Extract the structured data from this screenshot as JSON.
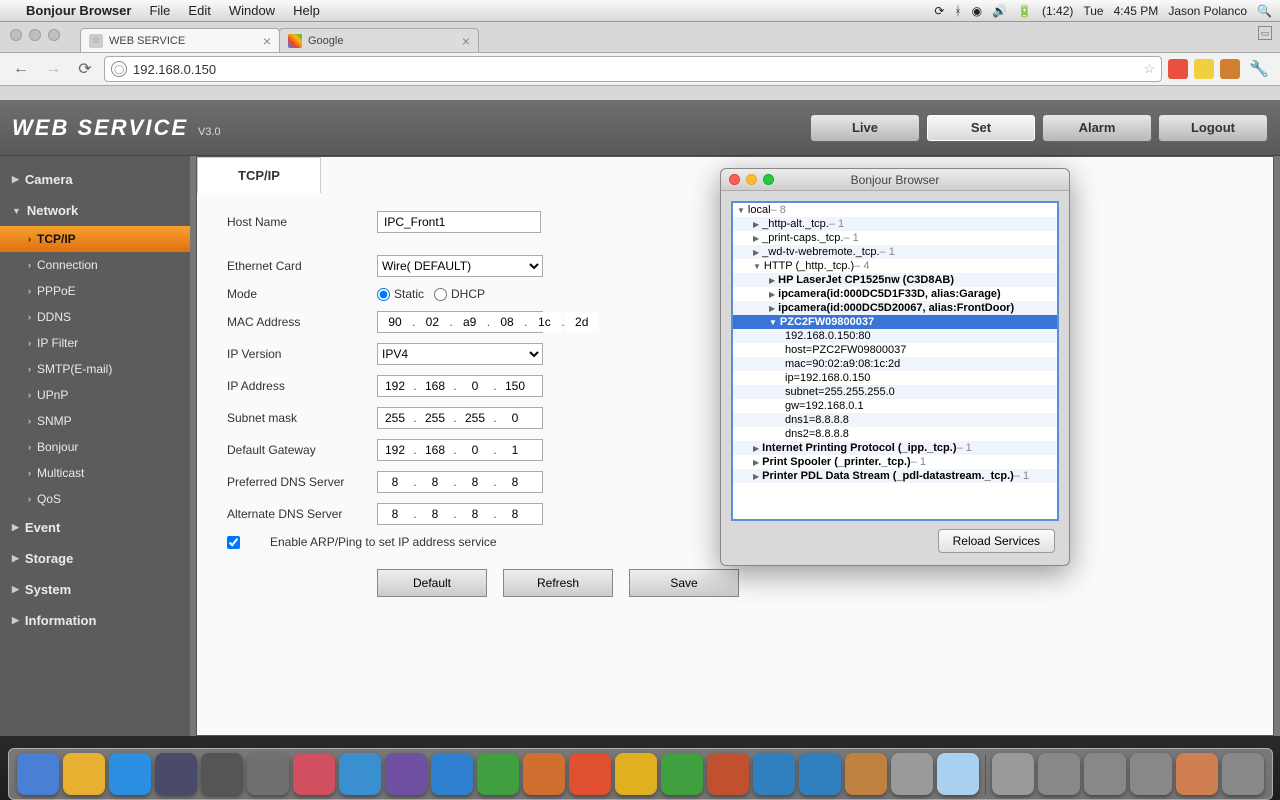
{
  "menubar": {
    "app": "Bonjour Browser",
    "items": [
      "File",
      "Edit",
      "Window",
      "Help"
    ],
    "battery": "(1:42)",
    "day": "Tue",
    "time": "4:45 PM",
    "user": "Jason Polanco"
  },
  "chrome": {
    "tabs": [
      {
        "title": "WEB SERVICE",
        "active": true
      },
      {
        "title": "Google",
        "active": false
      }
    ],
    "url": "192.168.0.150"
  },
  "webservice": {
    "logo_main": "WEB  SERVICE",
    "logo_ver": "V3.0",
    "topnav": [
      "Live",
      "Set",
      "Alarm",
      "Logout"
    ],
    "topnav_active": 1,
    "sidebar": {
      "categories": [
        {
          "label": "Camera",
          "expanded": false
        },
        {
          "label": "Network",
          "expanded": true,
          "subs": [
            "TCP/IP",
            "Connection",
            "PPPoE",
            "DDNS",
            "IP Filter",
            "SMTP(E-mail)",
            "UPnP",
            "SNMP",
            "Bonjour",
            "Multicast",
            "QoS"
          ],
          "active": 0
        },
        {
          "label": "Event",
          "expanded": false
        },
        {
          "label": "Storage",
          "expanded": false
        },
        {
          "label": "System",
          "expanded": false
        },
        {
          "label": "Information",
          "expanded": false
        }
      ]
    },
    "panel": {
      "tab": "TCP/IP",
      "host_label": "Host Name",
      "host_value": "IPC_Front1",
      "eth_label": "Ethernet Card",
      "eth_value": "Wire( DEFAULT)",
      "mode_label": "Mode",
      "mode_static": "Static",
      "mode_dhcp": "DHCP",
      "mode_value": "static",
      "mac_label": "MAC Address",
      "mac": [
        "90",
        "02",
        "a9",
        "08",
        "1c",
        "2d"
      ],
      "ipver_label": "IP Version",
      "ipver_value": "IPV4",
      "ipaddr_label": "IP Address",
      "ipaddr": [
        "192",
        "168",
        "0",
        "150"
      ],
      "subnet_label": "Subnet mask",
      "subnet": [
        "255",
        "255",
        "255",
        "0"
      ],
      "gw_label": "Default Gateway",
      "gw": [
        "192",
        "168",
        "0",
        "1"
      ],
      "dns1_label": "Preferred DNS Server",
      "dns1": [
        "8",
        "8",
        "8",
        "8"
      ],
      "dns2_label": "Alternate DNS Server",
      "dns2": [
        "8",
        "8",
        "8",
        "8"
      ],
      "arp_label": "Enable ARP/Ping to set IP address service",
      "arp_checked": true,
      "btn_default": "Default",
      "btn_refresh": "Refresh",
      "btn_save": "Save"
    }
  },
  "bonjour": {
    "title": "Bonjour Browser",
    "reload": "Reload Services",
    "tree": [
      {
        "indent": 0,
        "tri": "▼",
        "text": "local",
        "count": " – 8"
      },
      {
        "indent": 1,
        "tri": "▶",
        "text": "_http-alt._tcp.",
        "count": " – 1"
      },
      {
        "indent": 1,
        "tri": "▶",
        "text": "_print-caps._tcp.",
        "count": " – 1"
      },
      {
        "indent": 1,
        "tri": "▶",
        "text": "_wd-tv-webremote._tcp.",
        "count": " – 1"
      },
      {
        "indent": 1,
        "tri": "▼",
        "text": "HTTP (_http._tcp.)",
        "count": " – 4"
      },
      {
        "indent": 2,
        "tri": "▶",
        "bold": true,
        "text": "HP LaserJet CP1525nw (C3D8AB)"
      },
      {
        "indent": 2,
        "tri": "▶",
        "bold": true,
        "text": "ipcamera(id:000DC5D1F33D, alias:Garage)"
      },
      {
        "indent": 2,
        "tri": "▶",
        "bold": true,
        "text": "ipcamera(id:000DC5D20067, alias:FrontDoor)"
      },
      {
        "indent": 2,
        "tri": "▼",
        "bold": true,
        "text": "PZC2FW09800037",
        "sel": true
      },
      {
        "indent": 3,
        "text": "192.168.0.150:80"
      },
      {
        "indent": 3,
        "text": "host=PZC2FW09800037"
      },
      {
        "indent": 3,
        "text": "mac=90:02:a9:08:1c:2d"
      },
      {
        "indent": 3,
        "text": "ip=192.168.0.150"
      },
      {
        "indent": 3,
        "text": "subnet=255.255.255.0"
      },
      {
        "indent": 3,
        "text": "gw=192.168.0.1"
      },
      {
        "indent": 3,
        "text": "dns1=8.8.8.8"
      },
      {
        "indent": 3,
        "text": "dns2=8.8.8.8"
      },
      {
        "indent": 1,
        "tri": "▶",
        "bold": true,
        "text": "Internet Printing Protocol (_ipp._tcp.)",
        "count": " – 1"
      },
      {
        "indent": 1,
        "tri": "▶",
        "bold": true,
        "text": "Print Spooler (_printer._tcp.)",
        "count": " – 1"
      },
      {
        "indent": 1,
        "tri": "▶",
        "bold": true,
        "text": "Printer PDL Data Stream (_pdl-datastream._tcp.)",
        "count": " – 1"
      }
    ]
  },
  "dock_colors": [
    "#4a7fd6",
    "#e8b030",
    "#2a8fe0",
    "#4a4a6a",
    "#555",
    "#707070",
    "#d05060",
    "#3a8fd0",
    "#7050a0",
    "#3080d0",
    "#40a040",
    "#d07030",
    "#e05030",
    "#e0b020",
    "#40a040",
    "#c05030",
    "#3080c0",
    "#3080c0",
    "#c08040",
    "#9a9a9a",
    "#aad0f0",
    "#9a9a9a",
    "#888",
    "#888",
    "#888",
    "#d08050",
    "#888"
  ]
}
